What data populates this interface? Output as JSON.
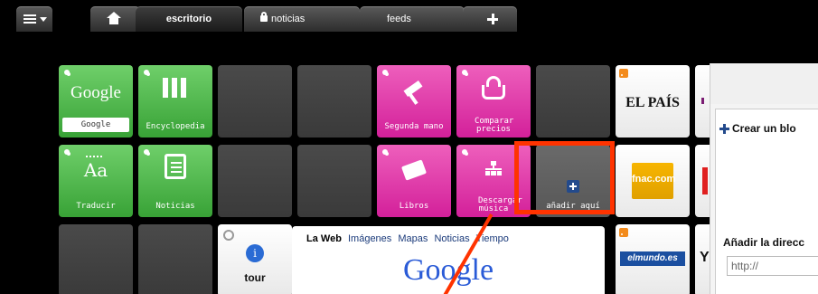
{
  "tabs": {
    "escritorio": "escritorio",
    "noticias": "noticias",
    "feeds": "feeds"
  },
  "tiles": {
    "google_logo": "Google",
    "google": "Google",
    "encyclopedia": "Encyclopedia",
    "segunda_mano": "Segunda mano",
    "comparar_precios": "Comparar precios",
    "traducir": "Traducir",
    "traducir_icon_text": "Aa",
    "noticias": "Noticias",
    "libros": "Libros",
    "descargar_musica": "Descargar música",
    "anadir_aqui": "añadir aquí",
    "el_pais": "EL PAÍS",
    "fnac": "fnac.com",
    "elmundo": "elmundo.es",
    "tour": "tour"
  },
  "google_widget": {
    "links": [
      "La Web",
      "Imágenes",
      "Mapas",
      "Noticias",
      "Tiempo"
    ],
    "logo": "Google"
  },
  "side_panel": {
    "create_blog": "Crear un blo",
    "add_address": "Añadir la direcc",
    "url_value": "http://"
  },
  "colors": {
    "green": "#4db84a",
    "pink": "#e23aab",
    "highlight": "#ff3300"
  }
}
